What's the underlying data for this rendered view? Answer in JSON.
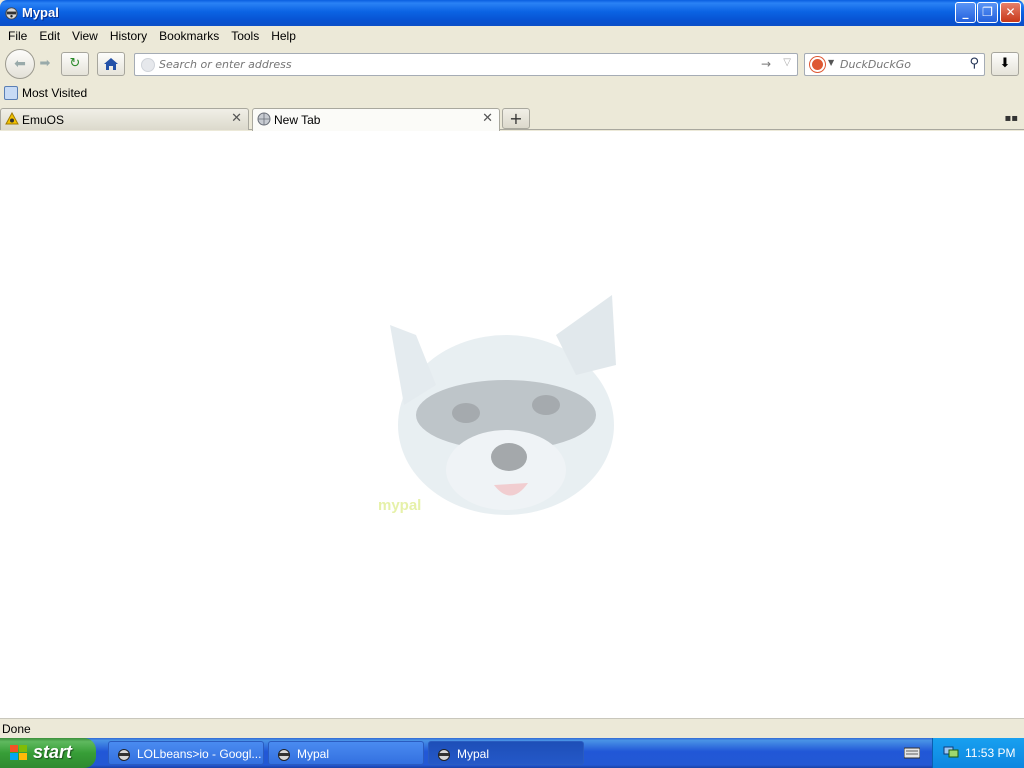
{
  "window": {
    "title": "Mypal",
    "buttons": [
      "minimize",
      "restore",
      "close"
    ]
  },
  "menubar": {
    "items": [
      "File",
      "Edit",
      "View",
      "History",
      "Bookmarks",
      "Tools",
      "Help"
    ]
  },
  "navbar": {
    "address_placeholder": "Search or enter address",
    "search_placeholder": "DuckDuckGo"
  },
  "bookmarks": {
    "items": [
      {
        "label": "Most Visited"
      }
    ]
  },
  "tabs": [
    {
      "label": "EmuOS",
      "active": false
    },
    {
      "label": "New Tab",
      "active": true
    }
  ],
  "content": {
    "watermark": "mypal"
  },
  "status": {
    "text": "Done"
  },
  "taskbar": {
    "start_label": "start",
    "tasks": [
      {
        "label": "LOLbeans>io - Googl...",
        "active": false
      },
      {
        "label": "Mypal",
        "active": false
      },
      {
        "label": "Mypal",
        "active": true
      }
    ],
    "clock": "11:53 PM"
  },
  "colors": {
    "titlebar": "#0b63e3",
    "taskbar": "#2358d4",
    "start": "#379e37",
    "chrome": "#ece9d8"
  }
}
